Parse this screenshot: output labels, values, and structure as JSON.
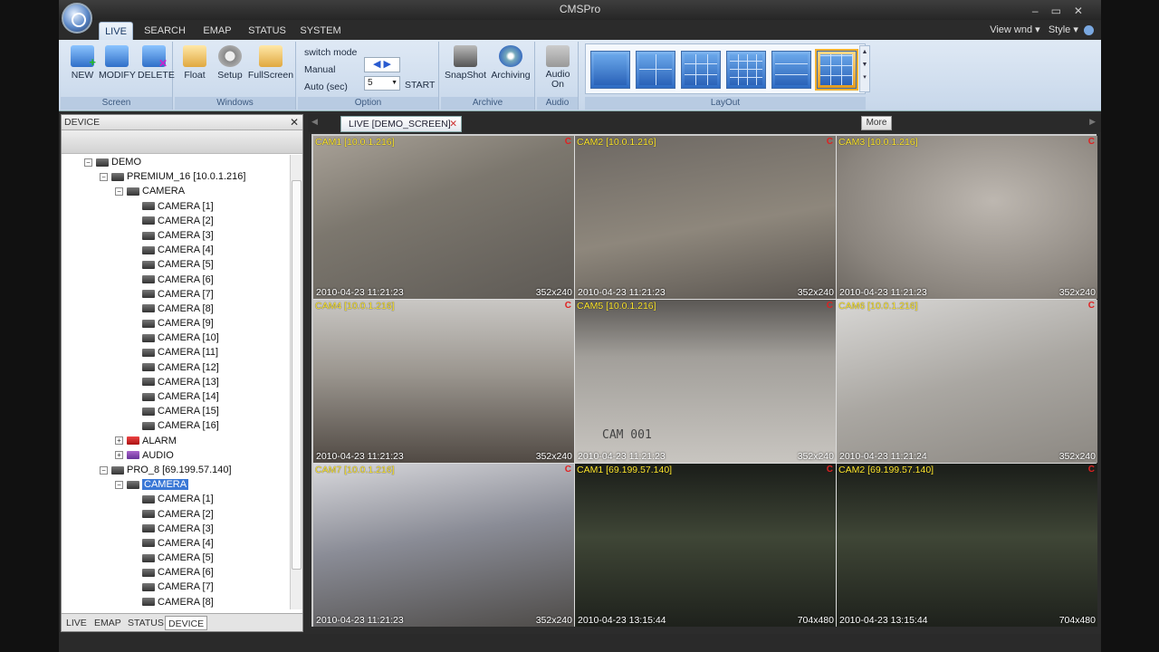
{
  "window": {
    "title": "CMSPro"
  },
  "menu": {
    "tabs": [
      "LIVE",
      "SEARCH",
      "EMAP",
      "STATUS",
      "SYSTEM"
    ],
    "view_wnd": "View wnd",
    "style": "Style"
  },
  "ribbon": {
    "screen": {
      "title": "Screen",
      "buttons": [
        "NEW",
        "MODIFY",
        "DELETE"
      ]
    },
    "windows": {
      "title": "Windows",
      "buttons": [
        "Float",
        "Setup",
        "FullScreen"
      ]
    },
    "option": {
      "title": "Option",
      "switch_mode": "switch mode",
      "manual": "Manual",
      "auto": "Auto (sec)",
      "auto_value": "5",
      "start": "START"
    },
    "archive": {
      "title": "Archive",
      "buttons": [
        "SnapShot",
        "Archiving"
      ]
    },
    "audio": {
      "title": "Audio",
      "button_line1": "Audio",
      "button_line2": "On"
    },
    "layout": {
      "title": "LayOut"
    }
  },
  "device_panel": {
    "title": "DEVICE",
    "tree": {
      "root": "DEMO",
      "premium": "PREMIUM_16 [10.0.1.216]",
      "camera_group": "CAMERA",
      "premium_cameras": [
        "CAMERA [1]",
        "CAMERA [2]",
        "CAMERA [3]",
        "CAMERA [4]",
        "CAMERA [5]",
        "CAMERA [6]",
        "CAMERA [7]",
        "CAMERA [8]",
        "CAMERA [9]",
        "CAMERA [10]",
        "CAMERA [11]",
        "CAMERA [12]",
        "CAMERA [13]",
        "CAMERA [14]",
        "CAMERA [15]",
        "CAMERA [16]"
      ],
      "alarm": "ALARM",
      "audio": "AUDIO",
      "pro8": "PRO_8 [69.199.57.140]",
      "pro8_camera_group": "CAMERA",
      "pro8_cameras": [
        "CAMERA [1]",
        "CAMERA [2]",
        "CAMERA [3]",
        "CAMERA [4]",
        "CAMERA [5]",
        "CAMERA [6]",
        "CAMERA [7]",
        "CAMERA [8]"
      ]
    },
    "bottom_tabs": [
      "LIVE",
      "EMAP",
      "STATUS",
      "DEVICE"
    ]
  },
  "live": {
    "tab_label": "LIVE [DEMO_SCREEN]",
    "more_label": "More",
    "cameras": [
      {
        "title": "CAM1 [10.0.1.216]",
        "rec": "C",
        "timestamp": "2010-04-23 11:21:23",
        "resolution": "352x240"
      },
      {
        "title": "CAM2 [10.0.1.216]",
        "rec": "C",
        "timestamp": "2010-04-23 11:21:23",
        "resolution": "352x240"
      },
      {
        "title": "CAM3 [10.0.1.216]",
        "rec": "C",
        "timestamp": "2010-04-23 11:21:23",
        "resolution": "352x240"
      },
      {
        "title": "CAM4 [10.0.1.216]",
        "rec": "C",
        "timestamp": "2010-04-23 11:21:23",
        "resolution": "352x240"
      },
      {
        "title": "CAM5 [10.0.1.216]",
        "rec": "C",
        "timestamp": "2010-04-23 11:21:23",
        "resolution": "352x240"
      },
      {
        "title": "CAM6 [10.0.1.216]",
        "rec": "C",
        "timestamp": "2010-04-23 11:21:24",
        "resolution": "352x240"
      },
      {
        "title": "CAM7 [10.0.1.216]",
        "rec": "C",
        "timestamp": "2010-04-23 11:21:23",
        "resolution": "352x240"
      },
      {
        "title": "CAM1 [69.199.57.140]",
        "rec": "C",
        "timestamp": "2010-04-23 13:15:44",
        "resolution": "704x480"
      },
      {
        "title": "CAM2 [69.199.57.140]",
        "rec": "C",
        "timestamp": "2010-04-23 13:15:44",
        "resolution": "704x480"
      }
    ],
    "cam5_overlay": "CAM 001"
  },
  "colors": {
    "camera_title": "#ffe830",
    "rec_indicator": "#e02020",
    "selected": "#3a78d6"
  }
}
